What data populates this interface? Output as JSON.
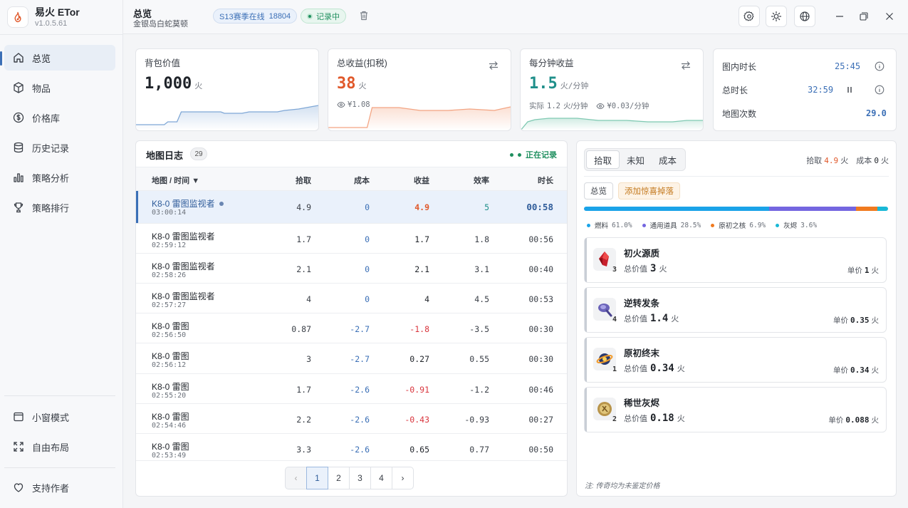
{
  "app": {
    "name": "易火 ETor",
    "version": "v1.0.5.61"
  },
  "nav": {
    "items": [
      {
        "label": "总览",
        "icon": "home-icon"
      },
      {
        "label": "物品",
        "icon": "box-icon"
      },
      {
        "label": "价格库",
        "icon": "dollar-icon"
      },
      {
        "label": "历史记录",
        "icon": "database-icon"
      },
      {
        "label": "策略分析",
        "icon": "bar-chart-icon"
      },
      {
        "label": "策略排行",
        "icon": "trophy-icon"
      }
    ],
    "bottom": [
      {
        "label": "小窗模式",
        "icon": "window-icon"
      },
      {
        "label": "自由布局",
        "icon": "expand-icon"
      }
    ],
    "support": "支持作者"
  },
  "header": {
    "title": "总览",
    "subtitle": "金银岛白蛇莫顿",
    "season_label": "S13赛季在线",
    "season_value": "18804",
    "recording": "记录中"
  },
  "cards": {
    "bag": {
      "label": "背包价值",
      "value": "1,000",
      "unit": "火"
    },
    "total": {
      "label": "总收益(扣税)",
      "value": "38",
      "unit": "火",
      "meta": "¥1.08"
    },
    "rate": {
      "label": "每分钟收益",
      "value": "1.5",
      "unit": "火/分钟",
      "actual_label": "实际",
      "actual_value": "1.2",
      "actual_unit": "火/分钟",
      "cny": "¥0.03/分钟"
    },
    "stats": {
      "in_map_label": "图内时长",
      "in_map_value": "25:45",
      "total_label": "总时长",
      "total_value": "32:59",
      "count_label": "地图次数",
      "count_value": "29.0"
    }
  },
  "map_log": {
    "title": "地图日志",
    "count": "29",
    "live": "正在记录",
    "columns": [
      "地图 / 时间 ▼",
      "拾取",
      "成本",
      "收益",
      "效率",
      "时长"
    ],
    "rows": [
      {
        "name": "K8-0 雷图监视者",
        "time": "03:00:14",
        "pickup": "4.9",
        "cost": "0",
        "profit": "4.9",
        "eff": "5",
        "dur": "00:58"
      },
      {
        "name": "K8-0 雷图监视者",
        "time": "02:59:12",
        "pickup": "1.7",
        "cost": "0",
        "profit": "1.7",
        "eff": "1.8",
        "dur": "00:56"
      },
      {
        "name": "K8-0 雷图监视者",
        "time": "02:58:26",
        "pickup": "2.1",
        "cost": "0",
        "profit": "2.1",
        "eff": "3.1",
        "dur": "00:40"
      },
      {
        "name": "K8-0 雷图监视者",
        "time": "02:57:27",
        "pickup": "4",
        "cost": "0",
        "profit": "4",
        "eff": "4.5",
        "dur": "00:53"
      },
      {
        "name": "K8-0 雷图",
        "time": "02:56:50",
        "pickup": "0.87",
        "cost": "-2.7",
        "profit": "-1.8",
        "eff": "-3.5",
        "dur": "00:30"
      },
      {
        "name": "K8-0 雷图",
        "time": "02:56:12",
        "pickup": "3",
        "cost": "-2.7",
        "profit": "0.27",
        "eff": "0.55",
        "dur": "00:30"
      },
      {
        "name": "K8-0 雷图",
        "time": "02:55:20",
        "pickup": "1.7",
        "cost": "-2.6",
        "profit": "-0.91",
        "eff": "-1.2",
        "dur": "00:46"
      },
      {
        "name": "K8-0 雷图",
        "time": "02:54:46",
        "pickup": "2.2",
        "cost": "-2.6",
        "profit": "-0.43",
        "eff": "-0.93",
        "dur": "00:27"
      },
      {
        "name": "K8-0 雷图",
        "time": "02:53:49",
        "pickup": "3.3",
        "cost": "-2.6",
        "profit": "0.65",
        "eff": "0.77",
        "dur": "00:50"
      }
    ],
    "pages": [
      "‹",
      "1",
      "2",
      "3",
      "4",
      "›"
    ]
  },
  "right": {
    "tabs": [
      "拾取",
      "未知",
      "成本"
    ],
    "pickup_label": "拾取",
    "pickup_value": "4.9",
    "pickup_unit": "火",
    "cost_label": "成本",
    "cost_value": "0",
    "cost_unit": "火",
    "filter_all": "总览",
    "filter_add": "添加惊喜掉落",
    "distribution": [
      {
        "name": "燃料",
        "pct": "61.0%",
        "value": 61.0,
        "color": "#1aa3e8"
      },
      {
        "name": "通用道具",
        "pct": "28.5%",
        "value": 28.5,
        "color": "#7466e0"
      },
      {
        "name": "原初之核",
        "pct": "6.9%",
        "value": 6.9,
        "color": "#f07a1f"
      },
      {
        "name": "灰烬",
        "pct": "3.6%",
        "value": 3.6,
        "color": "#19b8d6"
      }
    ],
    "items": [
      {
        "name": "初火源质",
        "qty": "3",
        "total_label": "总价值",
        "total": "3",
        "total_unit": "火",
        "unit_label": "单价",
        "unit_price": "1",
        "unit_unit": "火",
        "icon": "red-crystal-icon"
      },
      {
        "name": "逆转发条",
        "qty": "4",
        "total_label": "总价值",
        "total": "1.4",
        "total_unit": "火",
        "unit_label": "单价",
        "unit_price": "0.35",
        "unit_unit": "火",
        "icon": "purple-clockwork-icon"
      },
      {
        "name": "原初终末",
        "qty": "1",
        "total_label": "总价值",
        "total": "0.34",
        "total_unit": "火",
        "unit_label": "单价",
        "unit_price": "0.34",
        "unit_unit": "火",
        "icon": "core-orb-icon"
      },
      {
        "name": "稀世灰烬",
        "qty": "2",
        "total_label": "总价值",
        "total": "0.18",
        "total_unit": "火",
        "unit_label": "单价",
        "unit_price": "0.088",
        "unit_unit": "火",
        "icon": "gold-coin-icon"
      }
    ],
    "note": "注: 传奇均为未鉴定价格"
  }
}
